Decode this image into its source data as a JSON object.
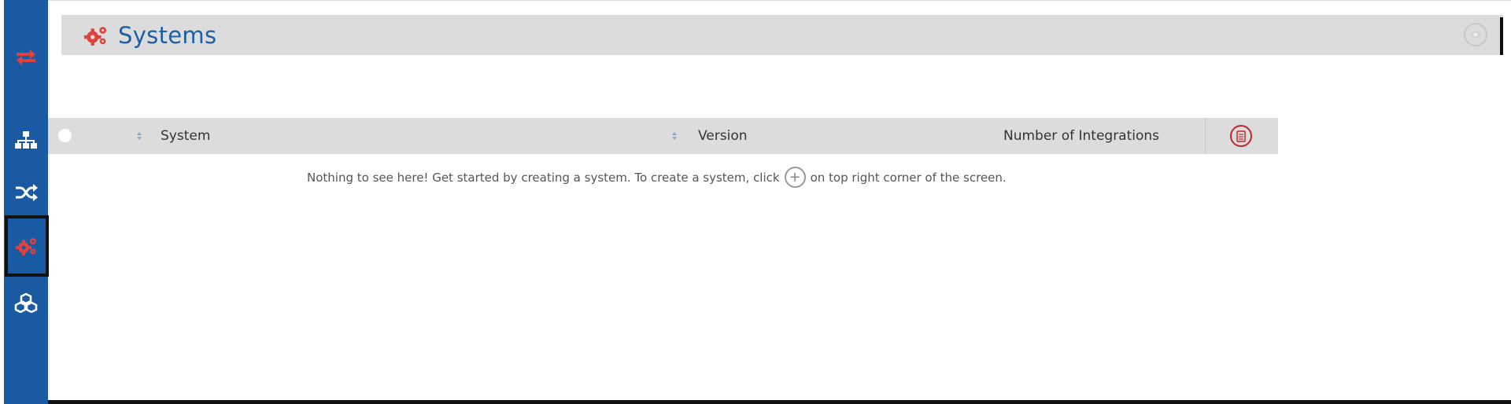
{
  "colors": {
    "sidebar": "#1a5aa3",
    "accent_red": "#e0413a",
    "header_bg": "#dcdcdc",
    "title_blue": "#1d5fa6"
  },
  "sidebar": {
    "items": [
      {
        "icon": "refresh-arrows-icon",
        "active": false
      },
      {
        "icon": "sitemap-icon",
        "active": false
      },
      {
        "icon": "shuffle-icon",
        "active": false
      },
      {
        "icon": "gears-icon",
        "active": true
      },
      {
        "icon": "cubes-icon",
        "active": false
      }
    ]
  },
  "header": {
    "title": "Systems",
    "icon": "gears-icon",
    "right_icon": "eye-icon"
  },
  "table": {
    "columns": [
      {
        "label": "System",
        "sortable": true
      },
      {
        "label": "Version",
        "sortable": true
      },
      {
        "label": "Number of Integrations",
        "sortable": false
      }
    ],
    "export_icon": "document-export-icon",
    "rows": []
  },
  "empty_state": {
    "text_before": "Nothing to see here! Get started by creating a system. To create a system, click",
    "icon": "plus-circle-icon",
    "text_after": "on top right corner of the screen."
  }
}
